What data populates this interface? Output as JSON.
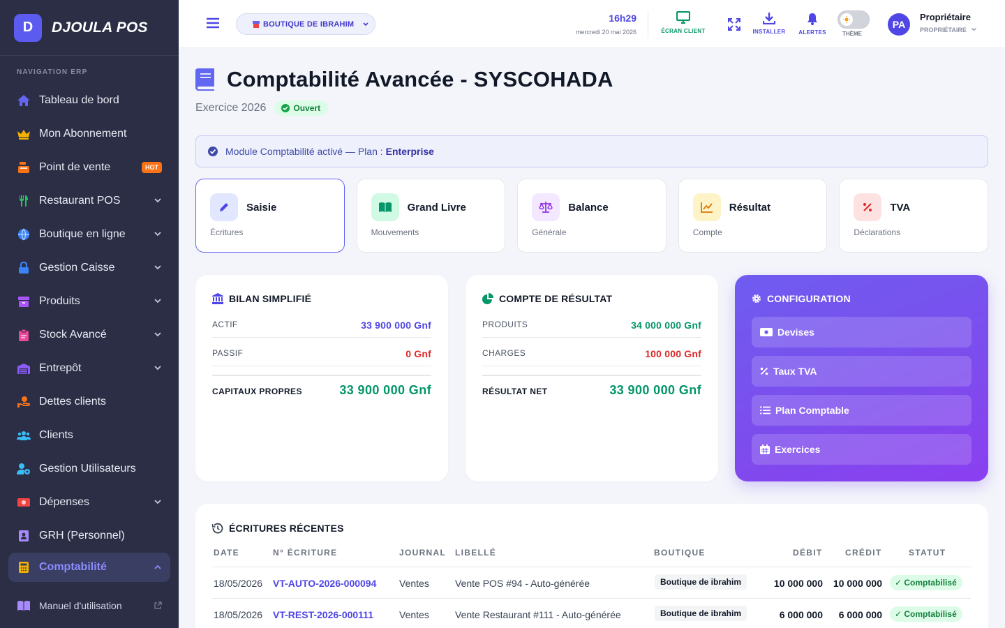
{
  "brand": {
    "logo_letter": "D",
    "name": "DJOULA POS"
  },
  "sidebar": {
    "section_label": "NAVIGATION ERP",
    "items": [
      {
        "label": "Tableau de bord",
        "icon": "home-icon",
        "color": "#6366f1"
      },
      {
        "label": "Mon Abonnement",
        "icon": "crown-icon",
        "color": "#f5b301"
      },
      {
        "label": "Point de vente",
        "icon": "cash-register-icon",
        "color": "#f97316",
        "badge": "HOT"
      },
      {
        "label": "Restaurant POS",
        "icon": "utensils-icon",
        "color": "#22c55e",
        "expandable": true
      },
      {
        "label": "Boutique en ligne",
        "icon": "globe-icon",
        "color": "#3b82f6",
        "expandable": true
      },
      {
        "label": "Gestion Caisse",
        "icon": "lock-icon",
        "color": "#3b82f6",
        "expandable": true
      },
      {
        "label": "Produits",
        "icon": "box-icon",
        "color": "#a855f7",
        "expandable": true
      },
      {
        "label": "Stock Avancé",
        "icon": "clipboard-icon",
        "color": "#ec4899",
        "expandable": true
      },
      {
        "label": "Entrepôt",
        "icon": "warehouse-icon",
        "color": "#8b5cf6",
        "expandable": true
      },
      {
        "label": "Dettes clients",
        "icon": "hand-money-icon",
        "color": "#f97316"
      },
      {
        "label": "Clients",
        "icon": "users-icon",
        "color": "#38bdf8"
      },
      {
        "label": "Gestion Utilisateurs",
        "icon": "user-gear-icon",
        "color": "#38bdf8"
      },
      {
        "label": "Dépenses",
        "icon": "money-bill-icon",
        "color": "#ef4444",
        "expandable": true
      },
      {
        "label": "GRH (Personnel)",
        "icon": "id-badge-icon",
        "color": "#a78bfa"
      },
      {
        "label": "Comptabilité",
        "icon": "calculator-icon",
        "color": "#f5b301",
        "expandable": true,
        "active": true
      }
    ],
    "manual_label": "Manuel d'utilisation"
  },
  "topbar": {
    "shop_label": "BOUTIQUE DE IBRAHIM",
    "time": "16h29",
    "date": "mercredi 20 mai 2026",
    "client_screen_label": "ÉCRAN CLIENT",
    "install_label": "INSTALLER",
    "alerts_label": "ALERTES",
    "theme_label": "THÈME",
    "avatar_initials": "PA",
    "user_name": "Propriétaire",
    "user_role": "PROPRIÉTAIRE"
  },
  "page": {
    "title": "Comptabilité Avancée - SYSCOHADA",
    "exercise": "Exercice 2026",
    "status": "Ouvert",
    "alert_text": "Module Comptabilité activé — Plan :",
    "alert_plan": "Enterprise"
  },
  "modules": [
    {
      "title": "Saisie",
      "subtitle": "Écritures",
      "icon": "pencil-icon",
      "bg": "#e0e7ff",
      "fg": "#4f46e5"
    },
    {
      "title": "Grand Livre",
      "subtitle": "Mouvements",
      "icon": "book-open-icon",
      "bg": "#d1fae5",
      "fg": "#059669"
    },
    {
      "title": "Balance",
      "subtitle": "Générale",
      "icon": "scale-icon",
      "bg": "#f3e8ff",
      "fg": "#9333ea"
    },
    {
      "title": "Résultat",
      "subtitle": "Compte",
      "icon": "chart-line-icon",
      "bg": "#fef3c7",
      "fg": "#d97706"
    },
    {
      "title": "TVA",
      "subtitle": "Déclarations",
      "icon": "percent-icon",
      "bg": "#fee2e2",
      "fg": "#dc2626"
    }
  ],
  "bilan": {
    "title": "BILAN SIMPLIFIÉ",
    "actif_label": "ACTIF",
    "actif_value": "33 900 000 Gnf",
    "passif_label": "PASSIF",
    "passif_value": "0 Gnf",
    "total_label": "CAPITAUX PROPRES",
    "total_value": "33 900 000 Gnf"
  },
  "resultat": {
    "title": "COMPTE DE RÉSULTAT",
    "produits_label": "PRODUITS",
    "produits_value": "34 000 000 Gnf",
    "charges_label": "CHARGES",
    "charges_value": "100 000 Gnf",
    "total_label": "RÉSULTAT NET",
    "total_value": "33 900 000 Gnf"
  },
  "config": {
    "title": "CONFIGURATION",
    "buttons": [
      "Devises",
      "Taux TVA",
      "Plan Comptable",
      "Exercices"
    ]
  },
  "recent": {
    "title": "ÉCRITURES RÉCENTES",
    "columns": [
      "DATE",
      "N° ÉCRITURE",
      "JOURNAL",
      "LIBELLÉ",
      "BOUTIQUE",
      "DÉBIT",
      "CRÉDIT",
      "STATUT"
    ],
    "rows": [
      {
        "date": "18/05/2026",
        "ref": "VT-AUTO-2026-000094",
        "journal": "Ventes",
        "label": "Vente POS #94 - Auto-générée",
        "shop": "Boutique de ibrahim",
        "debit": "10 000 000",
        "credit": "10 000 000",
        "status": "Comptabilisé"
      },
      {
        "date": "18/05/2026",
        "ref": "VT-REST-2026-000111",
        "journal": "Ventes",
        "label": "Vente Restaurant #111 - Auto-générée",
        "shop": "Boutique de ibrahim",
        "debit": "6 000 000",
        "credit": "6 000 000",
        "status": "Comptabilisé"
      }
    ]
  }
}
